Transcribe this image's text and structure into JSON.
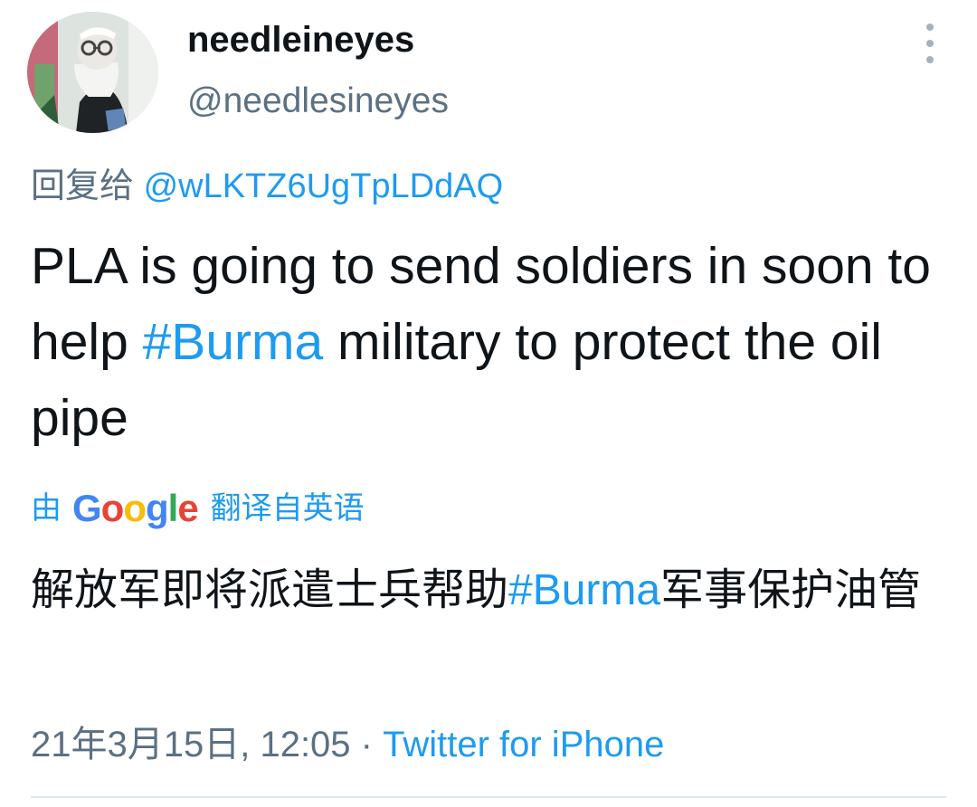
{
  "tweet": {
    "author": {
      "display_name": "needleineyes",
      "handle": "@needlesineyes",
      "avatar_icon": "avatar-photo"
    },
    "more_icon": "vertical-dots-icon",
    "reply": {
      "prefix": "回复给 ",
      "mention": "@wLKTZ6UgTpLDdAQ"
    },
    "text": {
      "part1": "PLA is going to send soldiers in soon to help ",
      "hashtag": "#Burma",
      "part2": " military to protect the oil pipe"
    },
    "translation": {
      "prefix": "由",
      "google_letters": [
        "G",
        "o",
        "o",
        "g",
        "l",
        "e"
      ],
      "suffix": "翻译自英语",
      "part1": "解放军即将派遣士兵帮助",
      "hashtag": "#Burma",
      "part2": "军事保护油管"
    },
    "meta": {
      "timestamp": "21年3月15日, 12:05",
      "separator": " · ",
      "source": "Twitter for iPhone"
    }
  },
  "colors": {
    "text": "#0f1419",
    "secondary": "#5b7083",
    "link": "#1d9bf0",
    "divider": "#e1e8ed"
  }
}
